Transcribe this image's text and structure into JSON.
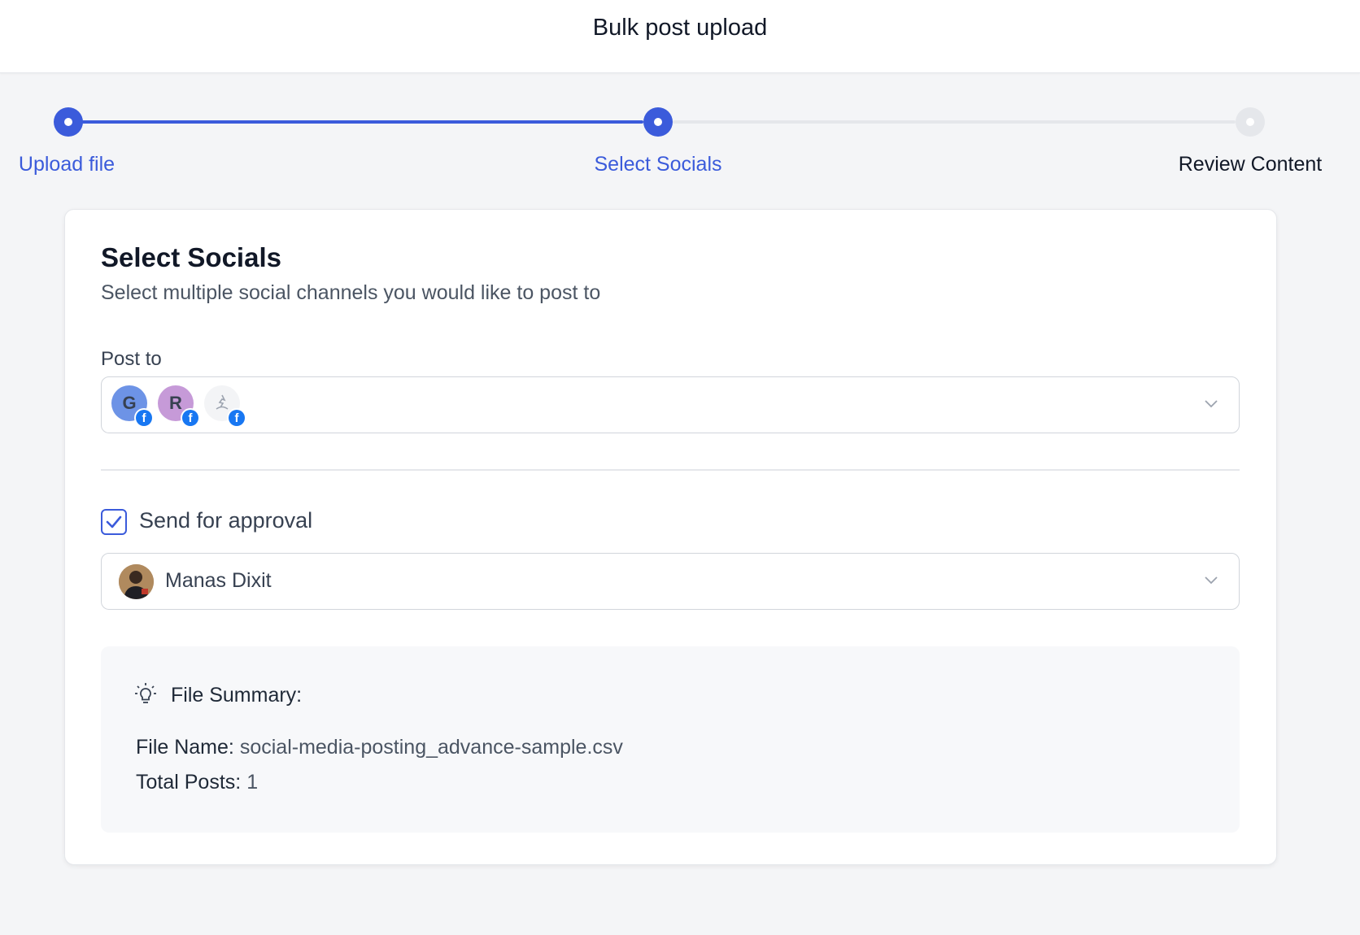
{
  "header": {
    "title": "Bulk post upload"
  },
  "stepper": {
    "steps": [
      {
        "label": "Upload file",
        "state": "completed"
      },
      {
        "label": "Select Socials",
        "state": "current"
      },
      {
        "label": "Review Content",
        "state": "upcoming"
      }
    ]
  },
  "card": {
    "title": "Select Socials",
    "subtitle": "Select multiple social channels you would like to post to",
    "post_to": {
      "label": "Post to",
      "channels": [
        {
          "initial": "G",
          "network": "facebook-icon",
          "color": "#6d93e6"
        },
        {
          "initial": "R",
          "network": "facebook-icon",
          "color": "#c69ad8"
        },
        {
          "initial": "",
          "network": "facebook-icon",
          "color": "#f3f4f6"
        }
      ]
    },
    "approval": {
      "checked": true,
      "label": "Send for approval",
      "approver": "Manas Dixit"
    },
    "file_summary": {
      "title": "File Summary:",
      "file_name_label": "File Name:",
      "file_name": "social-media-posting_advance-sample.csv",
      "total_posts_label": "Total Posts:",
      "total_posts": "1"
    }
  },
  "colors": {
    "accent": "#3b5bdb",
    "facebook": "#1877f2",
    "inactive": "#e5e7eb"
  }
}
